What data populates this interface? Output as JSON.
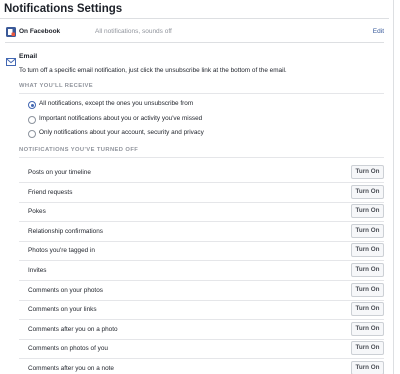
{
  "header": {
    "title": "Notifications Settings"
  },
  "on_facebook": {
    "label": "On Facebook",
    "value": "All notifications, sounds off",
    "edit_label": "Edit"
  },
  "email": {
    "title": "Email",
    "description": "To turn off a specific email notification, just click the unsubscribe link at the bottom of the email."
  },
  "receive": {
    "heading": "WHAT YOU'LL RECEIVE",
    "options": [
      {
        "label": "All notifications, except the ones you unsubscribe from",
        "selected": true
      },
      {
        "label": "Important notifications about you or activity you've missed",
        "selected": false
      },
      {
        "label": "Only notifications about your account, security and privacy",
        "selected": false
      }
    ]
  },
  "turned_off": {
    "heading": "NOTIFICATIONS YOU'VE TURNED OFF",
    "button_label": "Turn On",
    "items": [
      {
        "label": "Posts on your timeline"
      },
      {
        "label": "Friend requests"
      },
      {
        "label": "Pokes"
      },
      {
        "label": "Relationship confirmations"
      },
      {
        "label": "Photos you're tagged in"
      },
      {
        "label": "Invites"
      },
      {
        "label": "Comments on your photos"
      },
      {
        "label": "Comments on your links"
      },
      {
        "label": "Comments after you on a photo"
      },
      {
        "label": "Comments on photos of you"
      },
      {
        "label": "Comments after you on a note"
      }
    ]
  },
  "colors": {
    "accent": "#4267b2",
    "link": "#365899",
    "muted": "#90949c"
  }
}
